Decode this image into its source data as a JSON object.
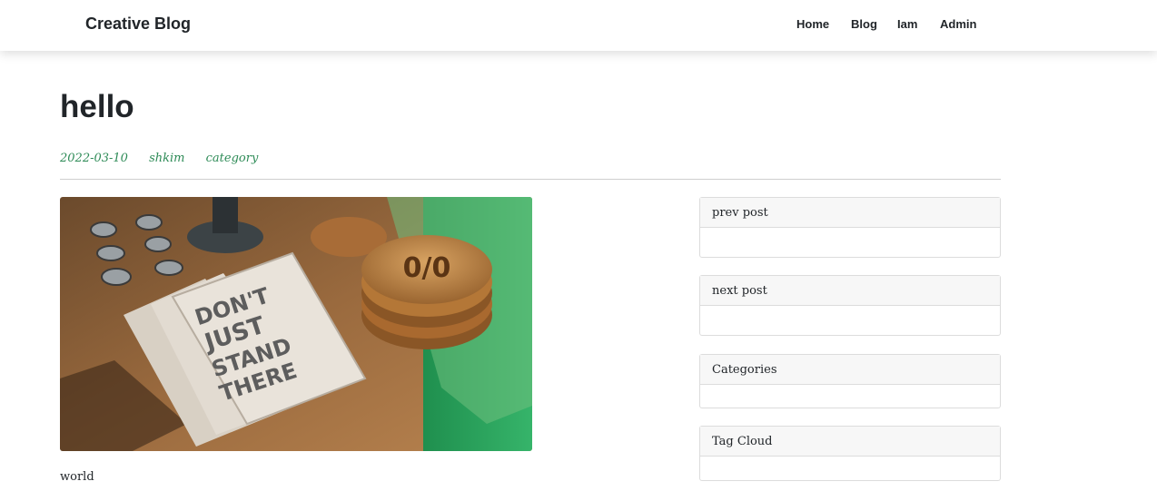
{
  "header": {
    "brand": "Creative Blog",
    "nav": [
      "Home",
      "Blog",
      "Iam",
      "Admin"
    ]
  },
  "post": {
    "title": "hello",
    "date": "2022-03-10",
    "author": "shkim",
    "category": "category",
    "image_alt": "Desk with notebooks reading DON'T JUST STAND THERE and wooden coasters",
    "image_text": "DON'T JUST STAND THERE",
    "body": "world"
  },
  "sidebar": {
    "prev_title": "prev post",
    "next_title": "next post",
    "categories_title": "Categories",
    "tags_title": "Tag Cloud"
  },
  "colors": {
    "accent": "#2e8b57",
    "text": "#212529",
    "card_header_bg": "#f7f7f7",
    "border": "#dcdcdc"
  }
}
